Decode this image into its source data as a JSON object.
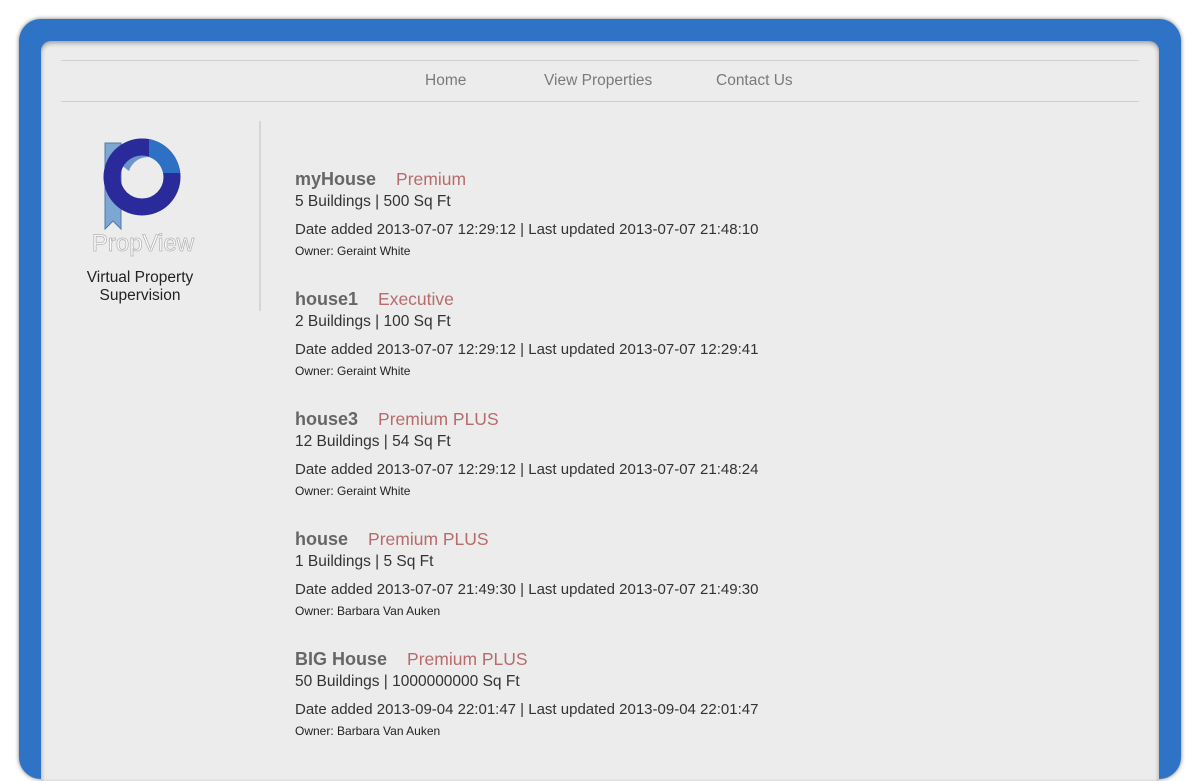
{
  "nav": {
    "items": [
      {
        "label": "Home"
      },
      {
        "label": "View Properties"
      },
      {
        "label": "Contact Us"
      }
    ]
  },
  "brand": {
    "logo_text": "PropView",
    "tagline_line1": "Virtual Property",
    "tagline_line2": "Supervision",
    "colors": {
      "frame": "#2e73c6",
      "logo_dark": "#2b2a9a",
      "logo_light": "#7ea6d3",
      "tier": "#b86b6b"
    }
  },
  "properties": [
    {
      "name": "myHouse",
      "tier": "Premium",
      "size": "5 Buildings | 500 Sq Ft",
      "dates": "Date added 2013-07-07 12:29:12 | Last updated 2013-07-07 21:48:10",
      "owner": "Owner: Geraint White"
    },
    {
      "name": "house1",
      "tier": "Executive",
      "size": "2 Buildings | 100 Sq Ft",
      "dates": "Date added 2013-07-07 12:29:12 | Last updated 2013-07-07 12:29:41",
      "owner": "Owner: Geraint White"
    },
    {
      "name": "house3",
      "tier": "Premium PLUS",
      "size": "12 Buildings | 54 Sq Ft",
      "dates": "Date added 2013-07-07 12:29:12 | Last updated 2013-07-07 21:48:24",
      "owner": "Owner: Geraint White"
    },
    {
      "name": "house",
      "tier": "Premium PLUS",
      "size": "1 Buildings | 5 Sq Ft",
      "dates": "Date added 2013-07-07 21:49:30 | Last updated 2013-07-07 21:49:30",
      "owner": "Owner: Barbara Van Auken"
    },
    {
      "name": "BIG House",
      "tier": "Premium PLUS",
      "size": "50 Buildings | 1000000000 Sq Ft",
      "dates": "Date added 2013-09-04 22:01:47 | Last updated 2013-09-04 22:01:47",
      "owner": "Owner: Barbara Van Auken"
    }
  ]
}
